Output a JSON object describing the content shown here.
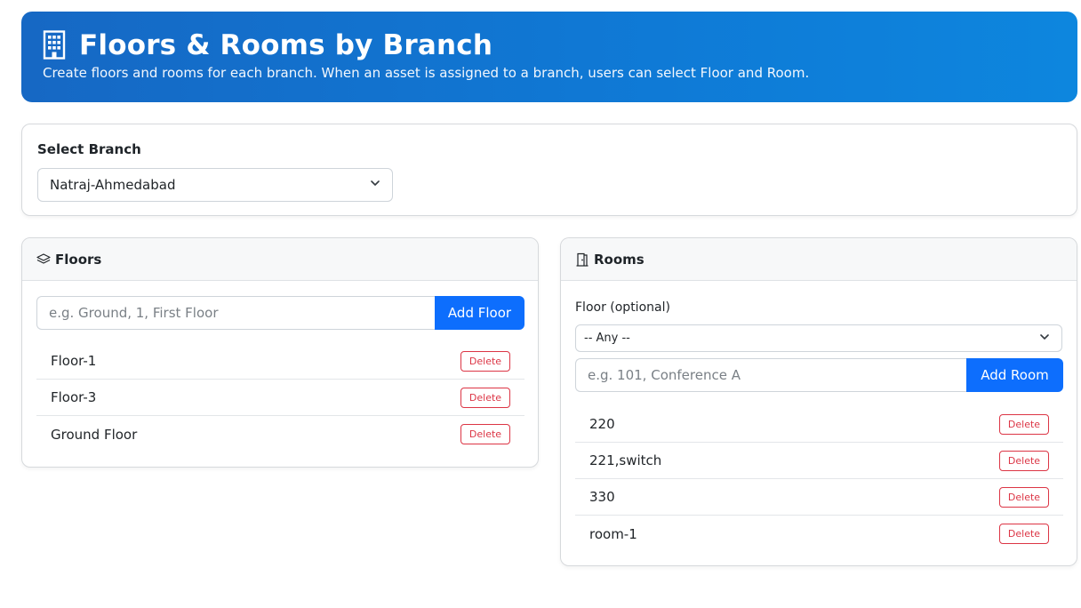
{
  "header": {
    "icon": "building-icon",
    "title": "Floors & Rooms by Branch",
    "subtitle": "Create floors and rooms for each branch. When an asset is assigned to a branch, users can select Floor and Room."
  },
  "branch": {
    "label": "Select Branch",
    "selected": "Natraj-Ahmedabad"
  },
  "floors": {
    "icon": "layers-icon",
    "title": "Floors",
    "input_placeholder": "e.g. Ground, 1, First Floor",
    "add_label": "Add Floor",
    "items": [
      {
        "name": "Floor-1",
        "delete_label": "Delete"
      },
      {
        "name": "Floor-3",
        "delete_label": "Delete"
      },
      {
        "name": "Ground Floor",
        "delete_label": "Delete"
      }
    ]
  },
  "rooms": {
    "icon": "door-icon",
    "title": "Rooms",
    "floor_label": "Floor (optional)",
    "floor_selected": "-- Any --",
    "input_placeholder": "e.g. 101, Conference A",
    "add_label": "Add Room",
    "items": [
      {
        "name": "220",
        "delete_label": "Delete"
      },
      {
        "name": "221,switch",
        "delete_label": "Delete"
      },
      {
        "name": "330",
        "delete_label": "Delete"
      },
      {
        "name": "room-1",
        "delete_label": "Delete"
      }
    ]
  },
  "colors": {
    "primary": "#0d6efd",
    "danger": "#dc3545",
    "hero_start": "#1668c4",
    "hero_end": "#0d86de"
  }
}
